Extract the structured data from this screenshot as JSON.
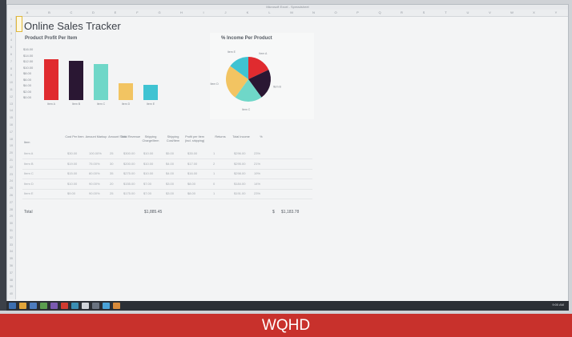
{
  "window_title": "Microsoft Excel - Spreadsheet",
  "columns": [
    "A",
    "B",
    "C",
    "D",
    "E",
    "F",
    "G",
    "H",
    "I",
    "J",
    "K",
    "L",
    "M",
    "N",
    "O",
    "P",
    "Q",
    "R",
    "S",
    "T",
    "U",
    "V",
    "W",
    "X",
    "Y"
  ],
  "rows": [
    "1",
    "2",
    "3",
    "4",
    "5",
    "6",
    "7",
    "8",
    "9",
    "10",
    "11",
    "12",
    "13",
    "14",
    "15",
    "16",
    "17",
    "18",
    "19",
    "20",
    "21",
    "22",
    "23",
    "24",
    "25",
    "26",
    "27",
    "28",
    "29",
    "30",
    "31",
    "32",
    "33",
    "34",
    "35",
    "36",
    "37",
    "38",
    "39",
    "40"
  ],
  "sheet": {
    "title": "Online Sales Tracker",
    "bar_chart": {
      "title": "Product Profit Per Item",
      "y_ticks": [
        "$16.00",
        "$14.00",
        "$12.00",
        "$10.00",
        "$8.00",
        "$6.00",
        "$4.00",
        "$2.00",
        "$0.00"
      ]
    },
    "pie_chart": {
      "title": "% Income Per Product"
    },
    "table": {
      "headers": [
        "Item",
        "Cost Per Item",
        "Amount Markup",
        "Amount Sold",
        "Total Revenue",
        "Shipping Charge/Item",
        "Shipping Cost/Item",
        "Profit per Item (incl. shipping)",
        "Returns",
        "Total Income",
        "%"
      ],
      "rows": [
        [
          "Item A",
          "$30.00",
          "100.00%",
          "25",
          "$300.00",
          "$10.00",
          "$5.00",
          "$35.00",
          "1",
          "$296.00",
          "23%"
        ],
        [
          "Item B",
          "$19.00",
          "75.00%",
          "30",
          "$200.00",
          "$10.00",
          "$4.00",
          "$17.00",
          "2",
          "$295.00",
          "21%"
        ],
        [
          "Item C",
          "$15.00",
          "80.00%",
          "35",
          "$275.00",
          "$10.00",
          "$4.00",
          "$16.00",
          "1",
          "$298.00",
          "19%"
        ],
        [
          "Item D",
          "$10.00",
          "90.00%",
          "20",
          "$155.00",
          "$7.00",
          "$3.00",
          "$8.00",
          "0",
          "$184.00",
          "14%"
        ],
        [
          "Item E",
          "$9.00",
          "90.00%",
          "25",
          "$175.00",
          "$7.00",
          "$3.00",
          "$8.00",
          "1",
          "$191.00",
          "23%"
        ]
      ],
      "total_label": "Total",
      "total_revenue": "$1,885.45",
      "total_income_prefix": "$",
      "total_income": "$1,183.78"
    }
  },
  "chart_data": [
    {
      "type": "bar",
      "title": "Product Profit Per Item",
      "categories": [
        "Item A",
        "Item B",
        "Item C",
        "Item D",
        "Item E"
      ],
      "values": [
        13.5,
        13,
        12,
        5.5,
        5
      ],
      "ylim": [
        0,
        16
      ],
      "colors": [
        "#e02b2f",
        "#2a1733",
        "#6fd7c8",
        "#f2c462",
        "#3fc3d2"
      ]
    },
    {
      "type": "pie",
      "title": "% Income Per Product",
      "categories": [
        "Item A",
        "Item B",
        "Item C",
        "Item D",
        "Item E"
      ],
      "values": [
        18,
        22,
        20,
        25,
        15
      ],
      "colors": [
        "#e02b2f",
        "#2a1733",
        "#6fd7c8",
        "#f2c462",
        "#3fc3d2"
      ]
    }
  ],
  "taskbar": {
    "clock": "9:00 AM"
  },
  "banner": {
    "label": "WQHD"
  }
}
